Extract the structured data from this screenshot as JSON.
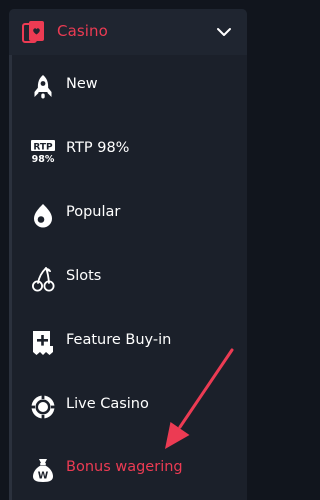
{
  "header": {
    "title": "Casino",
    "icon": "casino-cards-icon",
    "toggle_icon": "chevron-down-icon"
  },
  "menu": {
    "items": [
      {
        "label": "New",
        "icon": "rocket-icon"
      },
      {
        "label": "RTP 98%",
        "icon": "rtp-badge-icon",
        "icon_text_top": "RTP",
        "icon_text_bottom": "98%"
      },
      {
        "label": "Popular",
        "icon": "flame-drop-icon"
      },
      {
        "label": "Slots",
        "icon": "cherries-icon"
      },
      {
        "label": "Feature Buy-in",
        "icon": "ticket-plus-icon"
      },
      {
        "label": "Live Casino",
        "icon": "poker-chip-icon"
      },
      {
        "label": "Bonus wagering",
        "icon": "money-bag-icon",
        "icon_text": "W"
      }
    ]
  },
  "annotation": {
    "icon": "red-pointer-arrow"
  },
  "colors": {
    "background": "#11151d",
    "panel": "#1b202a",
    "header": "#1f2530",
    "accent": "#ec3b53",
    "text": "#ffffff"
  }
}
